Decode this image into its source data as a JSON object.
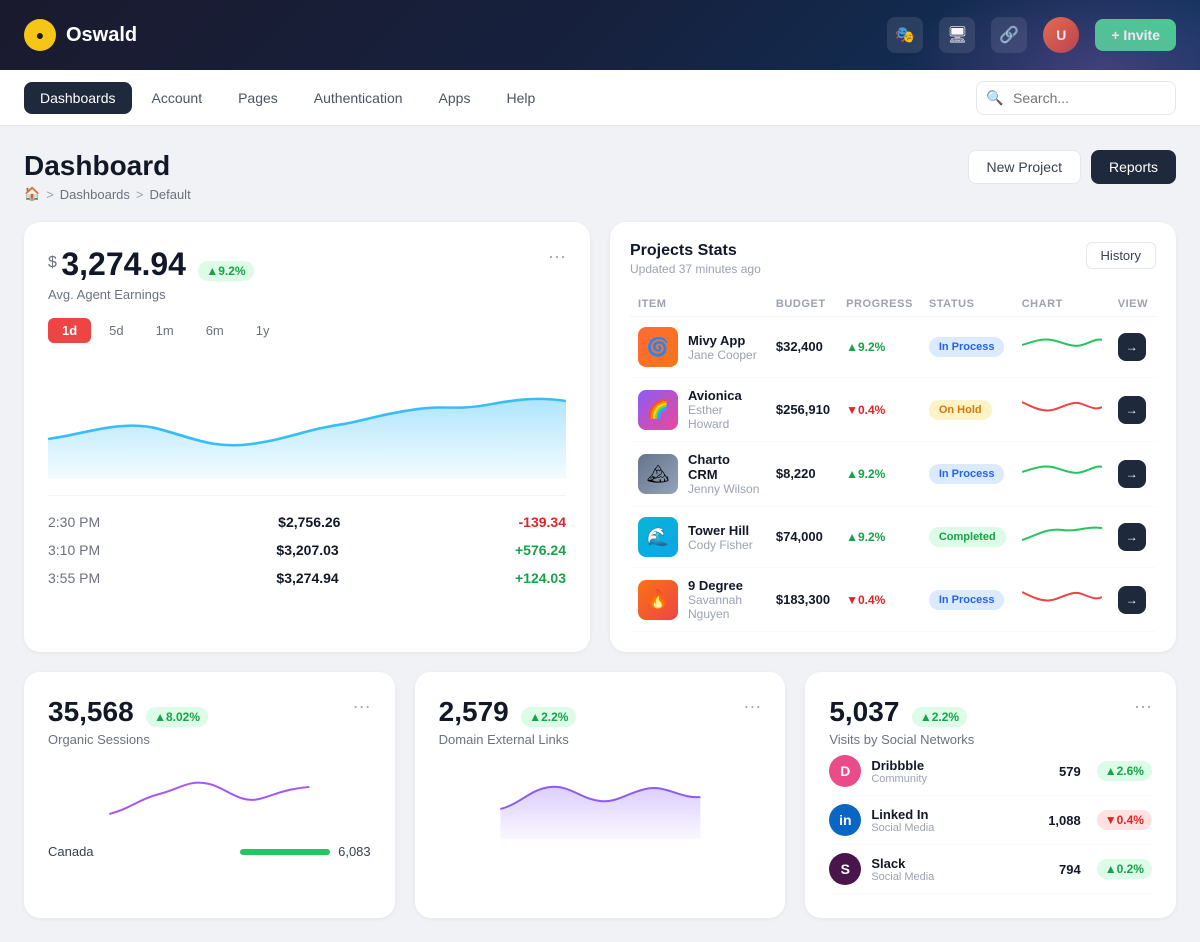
{
  "app": {
    "logo_initial": "O",
    "logo_name": "Oswald"
  },
  "topnav": {
    "icons": [
      "🎭",
      "💻",
      "🔗"
    ],
    "invite_label": "+ Invite"
  },
  "secondnav": {
    "items": [
      "Dashboards",
      "Account",
      "Pages",
      "Authentication",
      "Apps",
      "Help"
    ],
    "active": "Dashboards",
    "search_placeholder": "Search..."
  },
  "page": {
    "title": "Dashboard",
    "breadcrumb": [
      "🏠",
      "Dashboards",
      "Default"
    ],
    "btn_new_project": "New Project",
    "btn_reports": "Reports"
  },
  "earnings": {
    "currency": "$",
    "amount": "3,274.94",
    "badge": "▲9.2%",
    "subtitle": "Avg. Agent Earnings",
    "more": "···",
    "time_filters": [
      "1d",
      "5d",
      "1m",
      "6m",
      "1y"
    ],
    "active_filter": "1d",
    "rows": [
      {
        "time": "2:30 PM",
        "value": "$2,756.26",
        "change": "-139.34",
        "positive": false
      },
      {
        "time": "3:10 PM",
        "value": "$3,207.03",
        "change": "+576.24",
        "positive": true
      },
      {
        "time": "3:55 PM",
        "value": "$3,274.94",
        "change": "+124.03",
        "positive": true
      }
    ]
  },
  "projects": {
    "title": "Projects Stats",
    "subtitle": "Updated 37 minutes ago",
    "history_btn": "History",
    "columns": [
      "ITEM",
      "BUDGET",
      "PROGRESS",
      "STATUS",
      "CHART",
      "VIEW"
    ],
    "rows": [
      {
        "name": "Mivy App",
        "person": "Jane Cooper",
        "budget": "$32,400",
        "progress": "▲9.2%",
        "progress_up": true,
        "status": "In Process",
        "status_type": "inprocess",
        "color": "#ff6b35",
        "emoji": "🌀"
      },
      {
        "name": "Avionica",
        "person": "Esther Howard",
        "budget": "$256,910",
        "progress": "▼0.4%",
        "progress_up": false,
        "status": "On Hold",
        "status_type": "onhold",
        "color": "#8b5cf6",
        "emoji": "🌈"
      },
      {
        "name": "Charto CRM",
        "person": "Jenny Wilson",
        "budget": "$8,220",
        "progress": "▲9.2%",
        "progress_up": true,
        "status": "In Process",
        "status_type": "inprocess",
        "color": "#64748b",
        "emoji": "🏔"
      },
      {
        "name": "Tower Hill",
        "person": "Cody Fisher",
        "budget": "$74,000",
        "progress": "▲9.2%",
        "progress_up": true,
        "status": "Completed",
        "status_type": "completed",
        "color": "#06b6d4",
        "emoji": "🌊"
      },
      {
        "name": "9 Degree",
        "person": "Savannah Nguyen",
        "budget": "$183,300",
        "progress": "▼0.4%",
        "progress_up": false,
        "status": "In Process",
        "status_type": "inprocess",
        "color": "#f97316",
        "emoji": "🔥"
      }
    ]
  },
  "sessions": {
    "number": "35,568",
    "badge": "▲8.02%",
    "label": "Organic Sessions",
    "more": "···"
  },
  "links": {
    "number": "2,579",
    "badge": "▲2.2%",
    "label": "Domain External Links",
    "more": "···"
  },
  "social": {
    "number": "5,037",
    "badge": "▲2.2%",
    "label": "Visits by Social Networks",
    "more": "···",
    "items": [
      {
        "name": "Dribbble",
        "type": "Community",
        "value": "579",
        "change": "▲2.6%",
        "positive": true,
        "color": "#ea4c89",
        "initial": "D"
      },
      {
        "name": "Linked In",
        "type": "Social Media",
        "value": "1,088",
        "change": "▼0.4%",
        "positive": false,
        "color": "#0a66c2",
        "initial": "in"
      },
      {
        "name": "Slack",
        "type": "Social Media",
        "value": "794",
        "change": "▲0.2%",
        "positive": true,
        "color": "#4a154b",
        "initial": "S"
      }
    ]
  },
  "geo_data": [
    {
      "country": "Canada",
      "value": "6,083",
      "width": 90
    }
  ]
}
